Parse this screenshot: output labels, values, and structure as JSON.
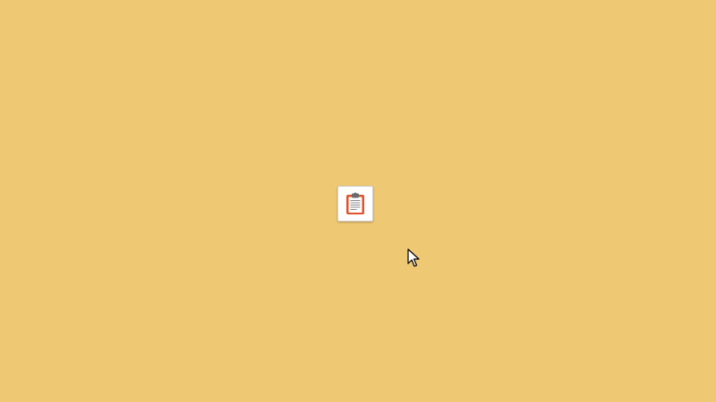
{
  "desktop": {
    "background_color": "#EFC873"
  },
  "tile": {
    "icon": "clipboard-icon"
  },
  "colors": {
    "clipboard_board": "#E0522C",
    "clipboard_paper": "#FFFFFF",
    "clipboard_clip": "#6B6B6B",
    "text_lines": "#8A8A8A"
  }
}
